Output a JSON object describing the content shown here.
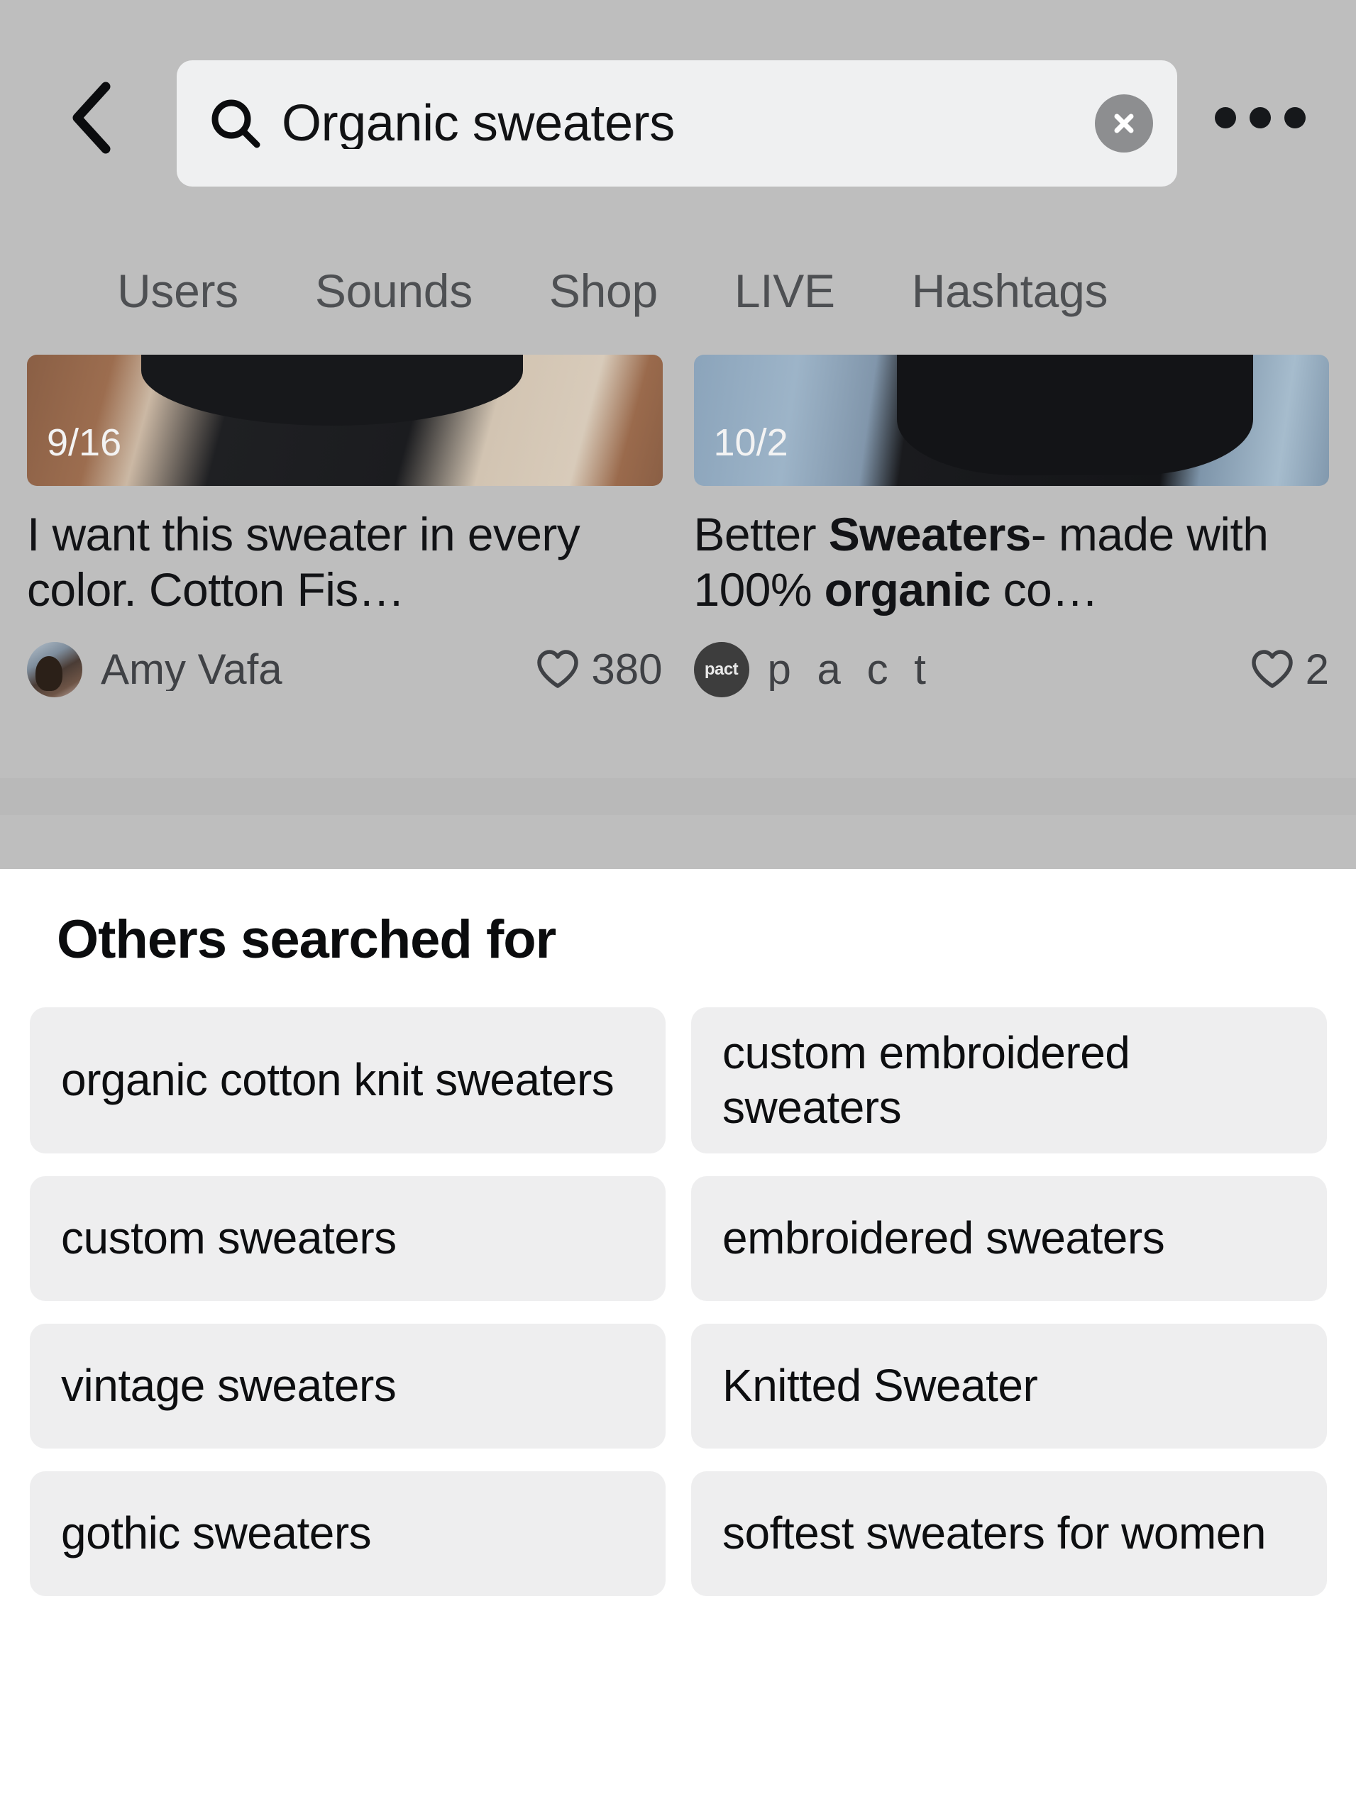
{
  "topbar": {
    "back_label": "Back",
    "search": {
      "value": "Organic sweaters",
      "placeholder": "Search",
      "clear_label": "Clear"
    },
    "more_label": "More options"
  },
  "tabs": [
    {
      "label": "Users"
    },
    {
      "label": "Sounds"
    },
    {
      "label": "Shop"
    },
    {
      "label": "LIVE"
    },
    {
      "label": "Hashtags"
    }
  ],
  "results": [
    {
      "date": "9/16",
      "caption_parts": [
        {
          "text": "I want this sweater in every color. Cotton Fis…",
          "bold": false
        }
      ],
      "author": "Amy Vafa",
      "avatar_text": "",
      "likes": "380"
    },
    {
      "date": "10/2",
      "caption_parts": [
        {
          "text": "Better ",
          "bold": false
        },
        {
          "text": "Sweaters",
          "bold": true
        },
        {
          "text": "- made with 100% ",
          "bold": false
        },
        {
          "text": "organic",
          "bold": true
        },
        {
          "text": " co…",
          "bold": false
        }
      ],
      "author": "p a c t",
      "avatar_text": "pact",
      "likes": "2"
    }
  ],
  "sheet": {
    "title": "Others searched for",
    "chips": [
      {
        "label": "organic cotton knit sweaters"
      },
      {
        "label": "custom embroidered sweaters"
      },
      {
        "label": "custom sweaters"
      },
      {
        "label": "embroidered sweaters"
      },
      {
        "label": "vintage sweaters"
      },
      {
        "label": "Knitted Sweater"
      },
      {
        "label": "gothic sweaters"
      },
      {
        "label": "softest sweaters for women"
      }
    ]
  },
  "colors": {
    "backdrop": "#bebebe",
    "sheet_bg": "#ffffff",
    "chip_bg": "#eeeeef",
    "search_bg": "#eff0f1",
    "text_primary": "#0d0e10",
    "text_secondary": "#4e5053",
    "clear_btn": "#8d8e90"
  }
}
